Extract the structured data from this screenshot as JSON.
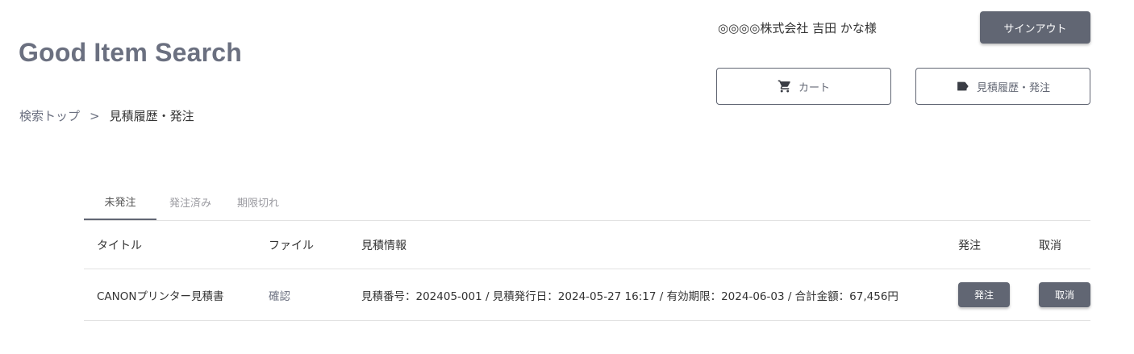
{
  "header": {
    "site_title": "Good Item Search",
    "user_name": "◎◎◎◎株式会社 吉田 かな様",
    "signout_label": "サインアウト",
    "cart_label": "カート",
    "history_label": "見積履歴・発注",
    "cart_icon": "cart-icon",
    "history_icon": "label-icon"
  },
  "breadcrumb": {
    "home": "検索トップ",
    "separator": ">",
    "current": "見積履歴・発注"
  },
  "tabs": [
    {
      "label": "未発注",
      "active": true
    },
    {
      "label": "発注済み",
      "active": false
    },
    {
      "label": "期限切れ",
      "active": false
    }
  ],
  "table": {
    "headers": {
      "title": "タイトル",
      "file": "ファイル",
      "info": "見積情報",
      "order": "発注",
      "cancel": "取消"
    },
    "rows": [
      {
        "title": "CANONプリンター見積書",
        "file": "確認",
        "info": "見積番号：202405-001 / 見積発行日：2024-05-27 16:17 / 有効期限：2024-06-03 / 合計金額：67,456円",
        "order_label": "発注",
        "cancel_label": "取消"
      }
    ]
  },
  "colors": {
    "primary": "#616673",
    "title": "#6b7080",
    "border": "#e2e2e2"
  }
}
